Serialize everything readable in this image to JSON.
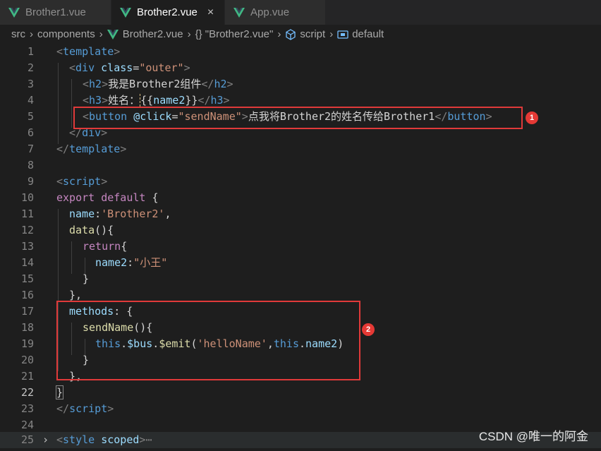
{
  "tabs": [
    {
      "label": "Brother1.vue",
      "active": false
    },
    {
      "label": "Brother2.vue",
      "active": true,
      "close": "×"
    },
    {
      "label": "App.vue",
      "active": false
    }
  ],
  "breadcrumb": {
    "items": [
      "src",
      "components",
      "Brother2.vue",
      "{} \"Brother2.vue\"",
      "script",
      "default"
    ]
  },
  "editor": {
    "active_line": 22,
    "lines": {
      "1": [
        "<",
        "template",
        ">"
      ],
      "2": [
        "<",
        "div",
        " class",
        "=",
        "\"outer\"",
        ">"
      ],
      "3": [
        "<",
        "h2",
        ">",
        "我是Brother2组件",
        "</",
        "h2",
        ">"
      ],
      "4": [
        "<",
        "h3",
        ">",
        "姓名：",
        "{{",
        "name2",
        "}}",
        "</",
        "h3",
        ">"
      ],
      "5": [
        "<",
        "button",
        " @click",
        "=",
        "\"sendName\"",
        ">",
        "点我将Brother2的姓名传给Brother1",
        "</",
        "button",
        ">"
      ],
      "6": [
        "</",
        "div",
        ">"
      ],
      "7": [
        "</",
        "template",
        ">"
      ],
      "9": [
        "<",
        "script",
        ">"
      ],
      "10": [
        "export",
        " default",
        " {"
      ],
      "11": [
        "name",
        ":",
        "'Brother2'",
        ","
      ],
      "12": [
        "data",
        "(){"
      ],
      "13": [
        "return",
        "{"
      ],
      "14": [
        "name2",
        ":",
        "\"小王\""
      ],
      "15": [
        "}"
      ],
      "16": [
        "},"
      ],
      "17": [
        "methods",
        ": {"
      ],
      "18": [
        "sendName",
        "(){"
      ],
      "19": [
        "this",
        ".",
        "$bus",
        ".",
        "$emit",
        "(",
        "'helloName'",
        ",",
        "this",
        ".",
        "name2",
        ")"
      ],
      "20": [
        "}"
      ],
      "21": [
        "},"
      ],
      "22": [
        "}"
      ],
      "23": [
        "</",
        "script",
        ">"
      ],
      "25": [
        "<",
        "style",
        " scoped",
        ">",
        "⋯"
      ]
    }
  },
  "annotations": [
    {
      "badge": "1"
    },
    {
      "badge": "2"
    }
  ],
  "watermark": "CSDN @唯一的阿金",
  "colors": {
    "background": "#1e1e1e",
    "tag": "#569cd6",
    "string": "#ce9178",
    "keyword": "#c586c0",
    "function": "#dcdcaa",
    "property": "#9cdcfe",
    "annotation": "#e03a3a"
  }
}
